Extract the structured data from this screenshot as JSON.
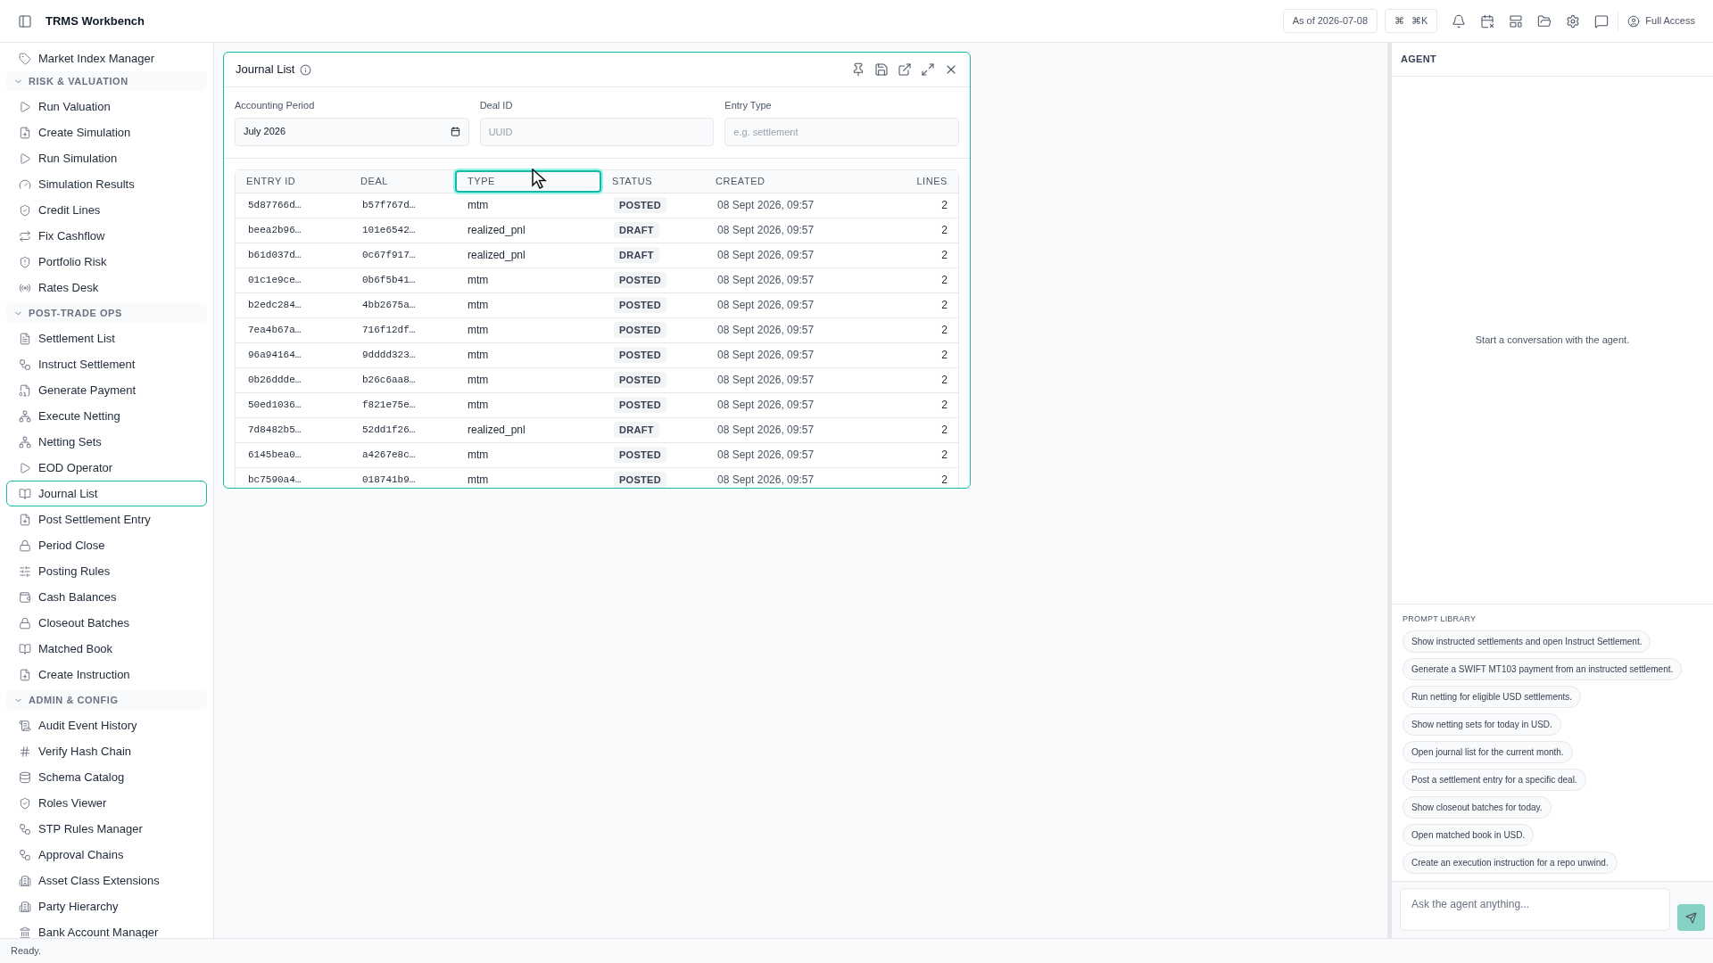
{
  "app": {
    "title": "TRMS Workbench",
    "as_of": "As of 2026-07-08",
    "shortcut_symbol": "⌘",
    "shortcut": "⌘K",
    "user": "Full Access"
  },
  "sidebar": {
    "items": [
      {
        "label": "Market Index Manager",
        "selected": false
      }
    ],
    "sections": [
      {
        "title": "RISK & VALUATION",
        "expanded": true,
        "items": [
          {
            "label": "Run Valuation",
            "selected": false
          },
          {
            "label": "Create Simulation",
            "selected": false
          },
          {
            "label": "Run Simulation",
            "selected": false
          },
          {
            "label": "Simulation Results",
            "selected": false
          },
          {
            "label": "Credit Lines",
            "selected": false
          },
          {
            "label": "Fix Cashflow",
            "selected": false
          },
          {
            "label": "Portfolio Risk",
            "selected": false
          },
          {
            "label": "Rates Desk",
            "selected": false
          }
        ]
      },
      {
        "title": "POST-TRADE OPS",
        "expanded": true,
        "items": [
          {
            "label": "Settlement List",
            "selected": false
          },
          {
            "label": "Instruct Settlement",
            "selected": false
          },
          {
            "label": "Generate Payment",
            "selected": false
          },
          {
            "label": "Execute Netting",
            "selected": false
          },
          {
            "label": "Netting Sets",
            "selected": false
          },
          {
            "label": "EOD Operator",
            "selected": false
          },
          {
            "label": "Journal List",
            "selected": true
          },
          {
            "label": "Post Settlement Entry",
            "selected": false
          },
          {
            "label": "Period Close",
            "selected": false
          },
          {
            "label": "Posting Rules",
            "selected": false
          },
          {
            "label": "Cash Balances",
            "selected": false
          },
          {
            "label": "Closeout Batches",
            "selected": false
          },
          {
            "label": "Matched Book",
            "selected": false
          },
          {
            "label": "Create Instruction",
            "selected": false
          }
        ]
      },
      {
        "title": "ADMIN & CONFIG",
        "expanded": true,
        "items": [
          {
            "label": "Audit Event History",
            "selected": false
          },
          {
            "label": "Verify Hash Chain",
            "selected": false
          },
          {
            "label": "Schema Catalog",
            "selected": false
          },
          {
            "label": "Roles Viewer",
            "selected": false
          },
          {
            "label": "STP Rules Manager",
            "selected": false
          },
          {
            "label": "Approval Chains",
            "selected": false
          },
          {
            "label": "Asset Class Extensions",
            "selected": false
          },
          {
            "label": "Party Hierarchy",
            "selected": false
          },
          {
            "label": "Bank Account Manager",
            "selected": false
          }
        ]
      }
    ]
  },
  "journal_panel": {
    "title": "Journal List",
    "filters": [
      {
        "label": "Accounting Period",
        "value": "July 2026",
        "kind": "month"
      },
      {
        "label": "Deal ID",
        "placeholder": "UUID",
        "kind": "text"
      },
      {
        "label": "Entry Type",
        "placeholder": "e.g. settlement",
        "kind": "text"
      }
    ],
    "table": {
      "columns": [
        {
          "label": "ENTRY ID",
          "focused": false
        },
        {
          "label": "DEAL",
          "focused": false
        },
        {
          "label": "TYPE",
          "focused": true
        },
        {
          "label": "STATUS",
          "focused": false
        },
        {
          "label": "CREATED",
          "focused": false
        },
        {
          "label": "LINES",
          "focused": false
        }
      ],
      "rows": [
        [
          "5d87766d…",
          "b57f767d…",
          "mtm",
          "POSTED",
          "08 Sept 2026, 09:57",
          "2"
        ],
        [
          "beea2b96…",
          "101e6542…",
          "realized_pnl",
          "DRAFT",
          "08 Sept 2026, 09:57",
          "2"
        ],
        [
          "b61d037d…",
          "0c67f917…",
          "realized_pnl",
          "DRAFT",
          "08 Sept 2026, 09:57",
          "2"
        ],
        [
          "01c1e9ce…",
          "0b6f5b41…",
          "mtm",
          "POSTED",
          "08 Sept 2026, 09:57",
          "2"
        ],
        [
          "b2edc284…",
          "4bb2675a…",
          "mtm",
          "POSTED",
          "08 Sept 2026, 09:57",
          "2"
        ],
        [
          "7ea4b67a…",
          "716f12df…",
          "mtm",
          "POSTED",
          "08 Sept 2026, 09:57",
          "2"
        ],
        [
          "96a94164…",
          "9dddd323…",
          "mtm",
          "POSTED",
          "08 Sept 2026, 09:57",
          "2"
        ],
        [
          "0b26ddde…",
          "b26c6aa8…",
          "mtm",
          "POSTED",
          "08 Sept 2026, 09:57",
          "2"
        ],
        [
          "50ed1036…",
          "f821e75e…",
          "mtm",
          "POSTED",
          "08 Sept 2026, 09:57",
          "2"
        ],
        [
          "7d8482b5…",
          "52dd1f26…",
          "realized_pnl",
          "DRAFT",
          "08 Sept 2026, 09:57",
          "2"
        ],
        [
          "6145bea0…",
          "a4267e8c…",
          "mtm",
          "POSTED",
          "08 Sept 2026, 09:57",
          "2"
        ],
        [
          "bc7590a4…",
          "018741b9…",
          "mtm",
          "POSTED",
          "08 Sept 2026, 09:57",
          "2"
        ]
      ]
    }
  },
  "agent": {
    "title": "AGENT",
    "empty_message": "Start a conversation with the agent.",
    "prompt_library_title": "PROMPT LIBRARY",
    "prompts": [
      "Show instructed settlements and open Instruct Settlement.",
      "Generate a SWIFT MT103 payment from an instructed settlement.",
      "Run netting for eligible USD settlements.",
      "Show netting sets for today in USD.",
      "Open journal list for the current month.",
      "Post a settlement entry for a specific deal.",
      "Show closeout batches for today.",
      "Open matched book in USD.",
      "Create an execution instruction for a repo unwind."
    ],
    "input_placeholder": "Ask the agent anything...",
    "send_disabled": true
  },
  "status_bar": "Ready."
}
